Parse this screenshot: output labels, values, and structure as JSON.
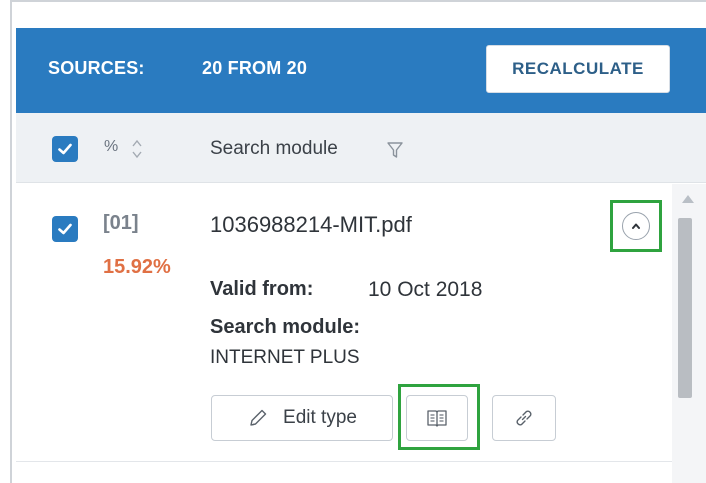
{
  "header": {
    "sources_label": "SOURCES:",
    "sources_count": "20 FROM 20",
    "recalculate_label": "RECALCULATE",
    "bg_color": "#2a7bc0"
  },
  "columns": {
    "select_all_checked": true,
    "percent_label": "%",
    "search_module_label": "Search module"
  },
  "source": {
    "checked": true,
    "index": "[01]",
    "percent": "15.92%",
    "percent_color": "#e07044",
    "filename": "1036988214-MIT.pdf",
    "valid_from_label": "Valid from:",
    "valid_from_value": "10 Oct 2018",
    "search_module_label": "Search module:",
    "search_module_value": "INTERNET PLUS",
    "edit_type_label": "Edit type"
  },
  "icons": {
    "sort": "sort-icon",
    "filter": "filter-icon",
    "collapse": "chevron-up-icon",
    "edit": "pencil-icon",
    "report": "book-icon",
    "link": "link-icon"
  },
  "highlight_color": "#2fa33f"
}
